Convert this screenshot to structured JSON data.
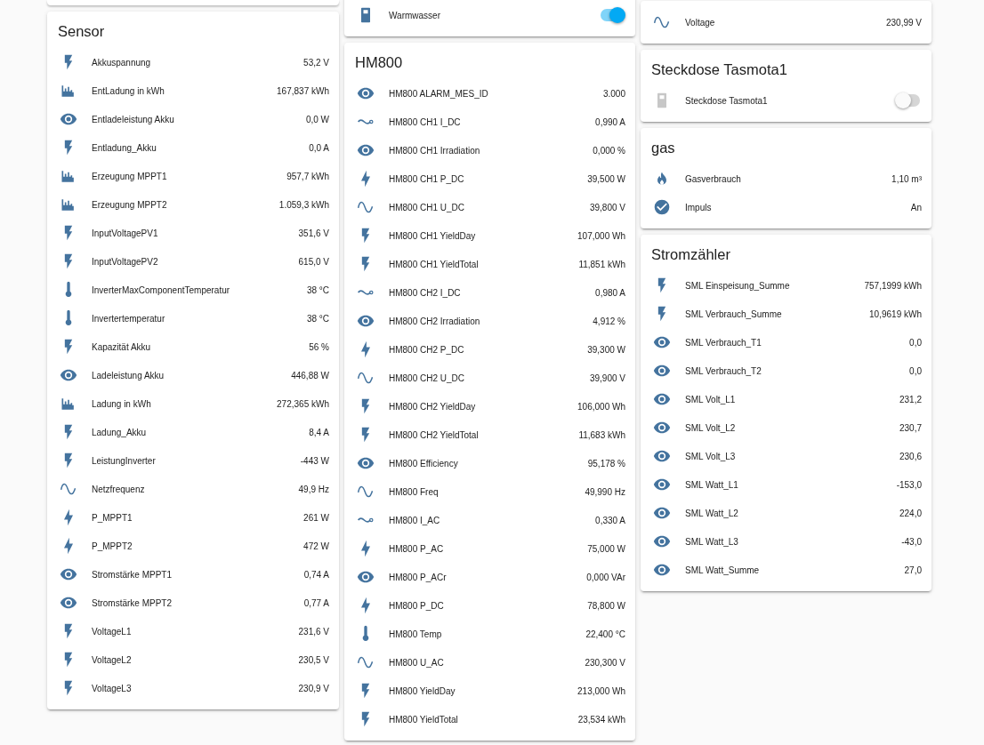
{
  "columns": [
    {
      "cards": [
        {
          "title": "Sensor",
          "rows": [
            {
              "kind": "flash",
              "name": "Akkuspannung",
              "value": "53,2 V"
            },
            {
              "kind": "energy",
              "name": "EntLadung in kWh",
              "value": "167,837 kWh"
            },
            {
              "kind": "eye",
              "name": "Entladeleistung Akku",
              "value": "0,0 W"
            },
            {
              "kind": "flash",
              "name": "Entladung_Akku",
              "value": "0,0 A"
            },
            {
              "kind": "energy",
              "name": "Erzeugung MPPT1",
              "value": "957,7 kWh"
            },
            {
              "kind": "energy",
              "name": "Erzeugung MPPT2",
              "value": "1.059,3 kWh"
            },
            {
              "kind": "flash",
              "name": "InputVoltagePV1",
              "value": "351,6 V"
            },
            {
              "kind": "flash",
              "name": "InputVoltagePV2",
              "value": "615,0 V"
            },
            {
              "kind": "temperature",
              "name": "InverterMaxComponentTemperatur",
              "value": "38 °C"
            },
            {
              "kind": "temperature",
              "name": "Invertertemperatur",
              "value": "38 °C"
            },
            {
              "kind": "flash",
              "name": "Kapazität Akku",
              "value": "56 %"
            },
            {
              "kind": "eye",
              "name": "Ladeleistung Akku",
              "value": "446,88 W"
            },
            {
              "kind": "energy",
              "name": "Ladung in kWh",
              "value": "272,365 kWh"
            },
            {
              "kind": "flash",
              "name": "Ladung_Akku",
              "value": "8,4 A"
            },
            {
              "kind": "flash",
              "name": "LeistungInverter",
              "value": "-443 W"
            },
            {
              "kind": "sine",
              "name": "Netzfrequenz",
              "value": "49,9 Hz"
            },
            {
              "kind": "power",
              "name": "P_MPPT1",
              "value": "261 W"
            },
            {
              "kind": "power",
              "name": "P_MPPT2",
              "value": "472 W"
            },
            {
              "kind": "eye",
              "name": "Stromstärke MPPT1",
              "value": "0,74 A"
            },
            {
              "kind": "eye",
              "name": "Stromstärke MPPT2",
              "value": "0,77 A"
            },
            {
              "kind": "flash",
              "name": "VoltageL1",
              "value": "231,6 V"
            },
            {
              "kind": "flash",
              "name": "VoltageL2",
              "value": "230,5 V"
            },
            {
              "kind": "flash",
              "name": "VoltageL3",
              "value": "230,9 V"
            }
          ]
        }
      ]
    },
    {
      "cards": [
        {
          "rows": [
            {
              "kind": "switch",
              "name": "Warmwasser",
              "on": true
            }
          ]
        },
        {
          "title": "HM800",
          "rows": [
            {
              "kind": "eye",
              "name": "HM800 ALARM_MES_ID",
              "value": "3.000"
            },
            {
              "kind": "current",
              "name": "HM800 CH1 I_DC",
              "value": "0,990 A"
            },
            {
              "kind": "eye",
              "name": "HM800 CH1 Irradiation",
              "value": "0,000 %"
            },
            {
              "kind": "power",
              "name": "HM800 CH1 P_DC",
              "value": "39,500 W"
            },
            {
              "kind": "sine",
              "name": "HM800 CH1 U_DC",
              "value": "39,800 V"
            },
            {
              "kind": "flash",
              "name": "HM800 CH1 YieldDay",
              "value": "107,000 Wh"
            },
            {
              "kind": "flash",
              "name": "HM800 CH1 YieldTotal",
              "value": "11,851 kWh"
            },
            {
              "kind": "current",
              "name": "HM800 CH2 I_DC",
              "value": "0,980 A"
            },
            {
              "kind": "eye",
              "name": "HM800 CH2 Irradiation",
              "value": "4,912 %"
            },
            {
              "kind": "power",
              "name": "HM800 CH2 P_DC",
              "value": "39,300 W"
            },
            {
              "kind": "sine",
              "name": "HM800 CH2 U_DC",
              "value": "39,900 V"
            },
            {
              "kind": "flash",
              "name": "HM800 CH2 YieldDay",
              "value": "106,000 Wh"
            },
            {
              "kind": "flash",
              "name": "HM800 CH2 YieldTotal",
              "value": "11,683 kWh"
            },
            {
              "kind": "eye",
              "name": "HM800 Efficiency",
              "value": "95,178 %"
            },
            {
              "kind": "sine",
              "name": "HM800 Freq",
              "value": "49,990 Hz"
            },
            {
              "kind": "current",
              "name": "HM800 I_AC",
              "value": "0,330 A"
            },
            {
              "kind": "power",
              "name": "HM800 P_AC",
              "value": "75,000 W"
            },
            {
              "kind": "eye",
              "name": "HM800 P_ACr",
              "value": "0,000 VAr"
            },
            {
              "kind": "power",
              "name": "HM800 P_DC",
              "value": "78,800 W"
            },
            {
              "kind": "temperature",
              "name": "HM800 Temp",
              "value": "22,400 °C"
            },
            {
              "kind": "sine",
              "name": "HM800 U_AC",
              "value": "230,300 V"
            },
            {
              "kind": "flash",
              "name": "HM800 YieldDay",
              "value": "213,000 Wh"
            },
            {
              "kind": "flash",
              "name": "HM800 YieldTotal",
              "value": "23,534 kWh"
            }
          ]
        }
      ]
    },
    {
      "cards": [
        {
          "rows": [
            {
              "kind": "sine",
              "name": "Voltage",
              "value": "230,99 V"
            }
          ]
        },
        {
          "title": "Steckdose Tasmota1",
          "rows": [
            {
              "kind": "switch",
              "name": "Steckdose Tasmota1",
              "on": false
            }
          ]
        },
        {
          "title": "gas",
          "rows": [
            {
              "kind": "gas",
              "name": "Gasverbrauch",
              "value": "1,10 m³"
            },
            {
              "kind": "check",
              "name": "Impuls",
              "value": "An"
            }
          ]
        },
        {
          "title": "Stromzähler",
          "rows": [
            {
              "kind": "flash",
              "name": "SML Einspeisung_Summe",
              "value": "757,1999 kWh"
            },
            {
              "kind": "flash",
              "name": "SML Verbrauch_Summe",
              "value": "10,9619 kWh"
            },
            {
              "kind": "eye",
              "name": "SML Verbrauch_T1",
              "value": "0,0"
            },
            {
              "kind": "eye",
              "name": "SML Verbrauch_T2",
              "value": "0,0"
            },
            {
              "kind": "eye",
              "name": "SML Volt_L1",
              "value": "231,2"
            },
            {
              "kind": "eye",
              "name": "SML Volt_L2",
              "value": "230,7"
            },
            {
              "kind": "eye",
              "name": "SML Volt_L3",
              "value": "230,6"
            },
            {
              "kind": "eye",
              "name": "SML Watt_L1",
              "value": "-153,0"
            },
            {
              "kind": "eye",
              "name": "SML Watt_L2",
              "value": "224,0"
            },
            {
              "kind": "eye",
              "name": "SML Watt_L3",
              "value": "-43,0"
            },
            {
              "kind": "eye",
              "name": "SML Watt_Summe",
              "value": "27,0"
            }
          ]
        }
      ]
    }
  ]
}
